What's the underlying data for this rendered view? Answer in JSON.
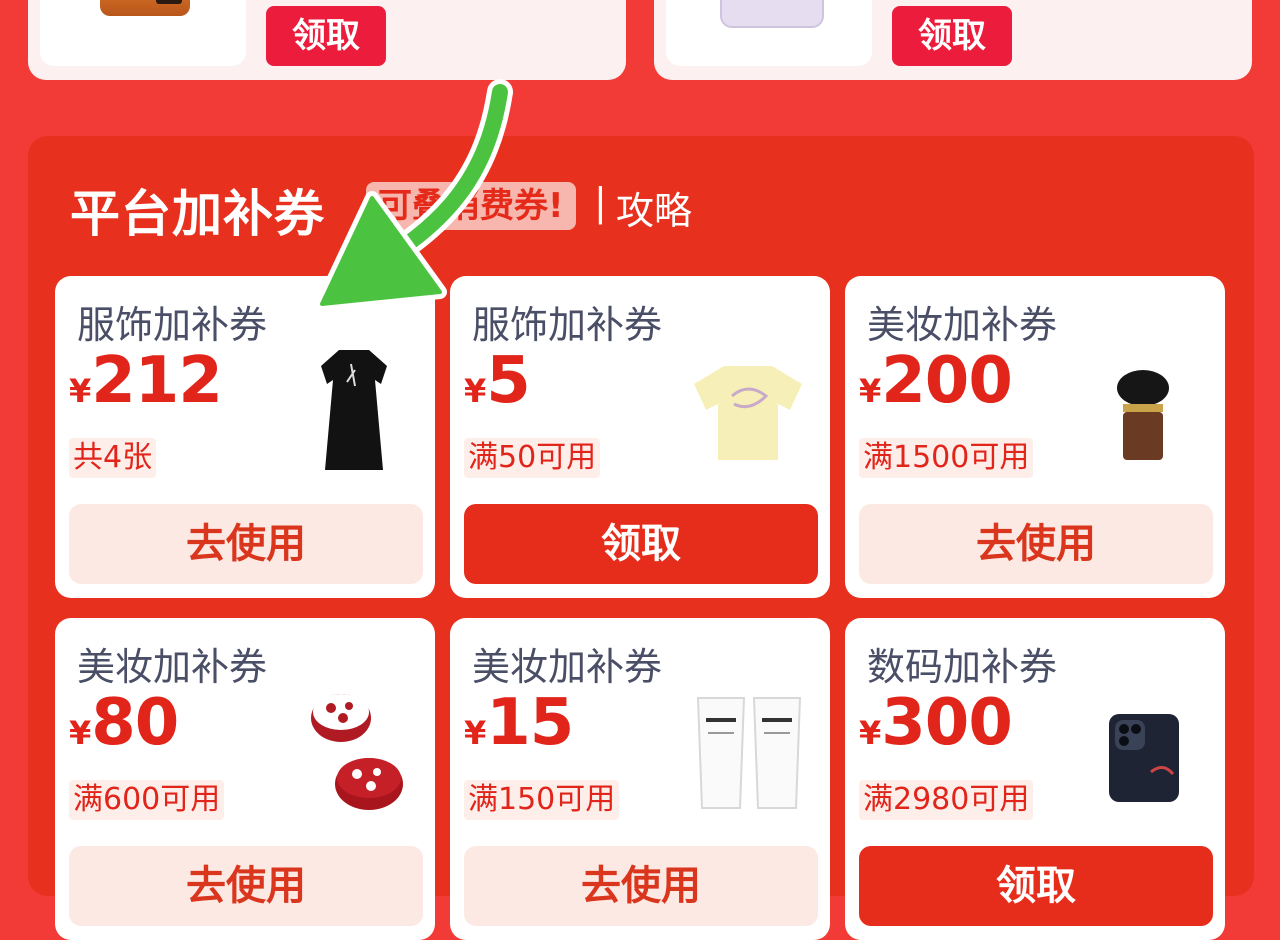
{
  "top_cards": [
    {
      "button_label": "领取",
      "image": "orange-product-thumbnail"
    },
    {
      "button_label": "领取",
      "image": "lilac-product-thumbnail"
    }
  ],
  "section": {
    "title": "平台加补券",
    "tag": "可叠消费券!",
    "separator": "|",
    "guide_link": "攻略"
  },
  "coupons": [
    {
      "name": "服饰加补券",
      "currency": "¥",
      "amount": "212",
      "condition": "共4张",
      "button": "去使用",
      "button_style": "use",
      "image": "black-dress"
    },
    {
      "name": "服饰加补券",
      "currency": "¥",
      "amount": "5",
      "condition": "满50可用",
      "button": "领取",
      "button_style": "get",
      "image": "yellow-tshirt"
    },
    {
      "name": "美妆加补券",
      "currency": "¥",
      "amount": "200",
      "condition": "满1500可用",
      "button": "去使用",
      "button_style": "use",
      "image": "makeup-brush"
    },
    {
      "name": "美妆加补券",
      "currency": "¥",
      "amount": "80",
      "condition": "满600可用",
      "button": "去使用",
      "button_style": "use",
      "image": "cushion-compacts"
    },
    {
      "name": "美妆加补券",
      "currency": "¥",
      "amount": "15",
      "condition": "满150可用",
      "button": "去使用",
      "button_style": "use",
      "image": "cleanser-tubes"
    },
    {
      "name": "数码加补券",
      "currency": "¥",
      "amount": "300",
      "condition": "满2980可用",
      "button": "领取",
      "button_style": "get",
      "image": "smartphone"
    }
  ],
  "colors": {
    "page_bg": "#f23a36",
    "section_bg": "#e8301e",
    "accent_red": "#e1251b",
    "annotation_arrow": "#4cc340"
  }
}
